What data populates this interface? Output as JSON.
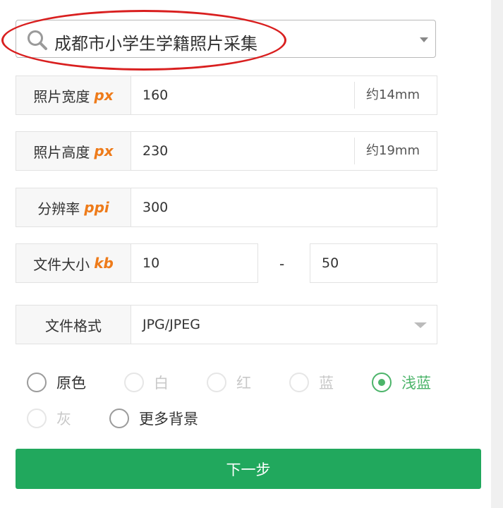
{
  "search_select": {
    "selected": "成都市小学生学籍照片采集"
  },
  "fields": {
    "width": {
      "label": "照片宽度",
      "unit": "px",
      "value": "160",
      "note": "约14mm"
    },
    "height": {
      "label": "照片高度",
      "unit": "px",
      "value": "230",
      "note": "约19mm"
    },
    "resolution": {
      "label": "分辨率",
      "unit": "ppi",
      "value": "300"
    },
    "filesize": {
      "label": "文件大小",
      "unit": "kb",
      "min": "10",
      "separator": "-",
      "max": "50"
    },
    "format": {
      "label": "文件格式",
      "value": "JPG/JPEG"
    }
  },
  "backgrounds": [
    {
      "label": "原色",
      "state": "enabled"
    },
    {
      "label": "白",
      "state": "disabled"
    },
    {
      "label": "红",
      "state": "disabled"
    },
    {
      "label": "蓝",
      "state": "disabled"
    },
    {
      "label": "浅蓝",
      "state": "checked"
    },
    {
      "label": "灰",
      "state": "disabled"
    },
    {
      "label": "更多背景",
      "state": "enabled"
    }
  ],
  "next_button": "下一步",
  "colors": {
    "accent_green": "#21a85d",
    "unit_orange": "#ee7b1a",
    "highlight_red": "#d91f1f",
    "checked_green": "#4cb46a"
  }
}
